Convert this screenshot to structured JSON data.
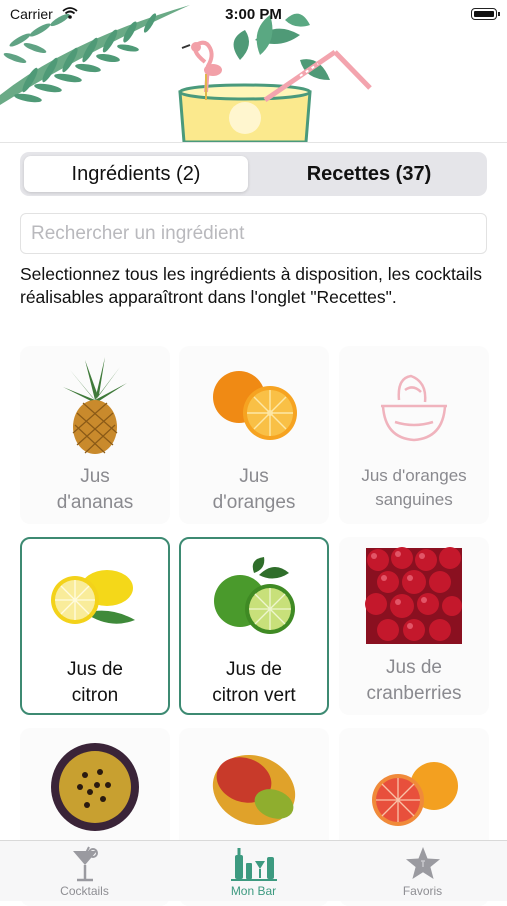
{
  "status_bar": {
    "carrier": "Carrier",
    "time": "3:00 PM"
  },
  "segments": {
    "ingredients": "Ingrédients (2)",
    "recipes": "Recettes (37)"
  },
  "search": {
    "placeholder": "Rechercher un ingrédient"
  },
  "instructions": "Selectionnez tous les ingrédients à disposition, les cocktails réalisables apparaîtront dans l'onglet \"Recettes\".",
  "ingredients": [
    {
      "line1": "Jus",
      "line2": "d'ananas",
      "selected": false,
      "icon": "pineapple-icon"
    },
    {
      "line1": "Jus",
      "line2": "d'oranges",
      "selected": false,
      "icon": "orange-icon"
    },
    {
      "line1": "Jus d'oranges",
      "line2": "sanguines",
      "selected": false,
      "icon": "bowl-icon"
    },
    {
      "line1": "Jus de",
      "line2": "citron",
      "selected": true,
      "icon": "lemon-icon"
    },
    {
      "line1": "Jus de",
      "line2": "citron vert",
      "selected": true,
      "icon": "lime-icon"
    },
    {
      "line1": "Jus de",
      "line2": "cranberries",
      "selected": false,
      "icon": "cranberries-icon"
    },
    {
      "line1": "",
      "line2": "",
      "selected": false,
      "icon": "passion-fruit-icon"
    },
    {
      "line1": "",
      "line2": "",
      "selected": false,
      "icon": "mango-icon"
    },
    {
      "line1": "",
      "line2": "",
      "selected": false,
      "icon": "grapefruit-icon"
    }
  ],
  "tabs": [
    {
      "label": "Cocktails",
      "icon": "cocktail-glass-icon",
      "active": false
    },
    {
      "label": "Mon Bar",
      "icon": "bar-bottles-icon",
      "active": true
    },
    {
      "label": "Favoris",
      "icon": "star-icon",
      "active": false
    }
  ],
  "colors": {
    "accent": "#3d8a72",
    "tab_active": "#3d9a80",
    "placeholder": "#b9b9bd"
  }
}
